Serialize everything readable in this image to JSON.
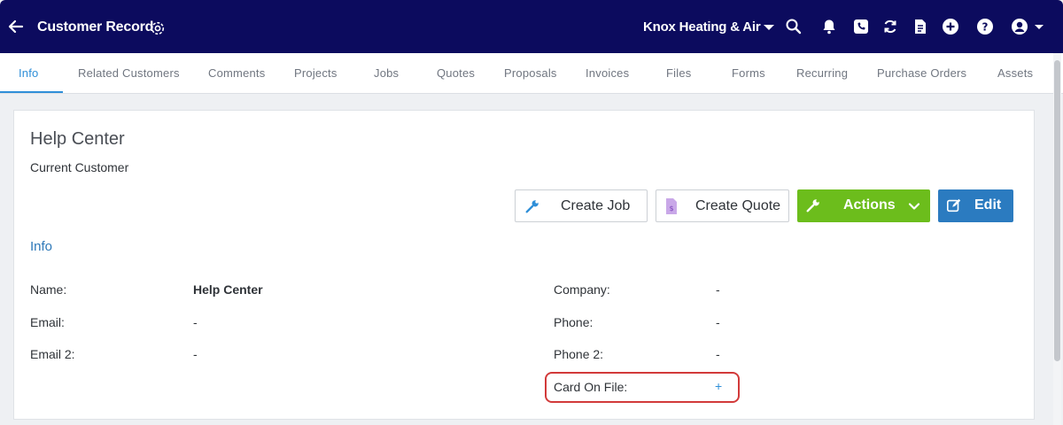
{
  "header": {
    "title": "Customer Record",
    "company": "Knox Heating & Air",
    "icons": [
      "back-arrow-icon",
      "gear-icon",
      "caret-down-icon",
      "search-icon",
      "bell-icon",
      "phone-icon",
      "sync-icon",
      "document-icon",
      "plus-circle-icon",
      "help-icon",
      "user-icon"
    ],
    "bg_color": "#0c0b5e"
  },
  "tabs": [
    {
      "label": "Info",
      "active": true
    },
    {
      "label": "Related Customers"
    },
    {
      "label": "Comments"
    },
    {
      "label": "Projects"
    },
    {
      "label": "Jobs"
    },
    {
      "label": "Quotes"
    },
    {
      "label": "Proposals"
    },
    {
      "label": "Invoices"
    },
    {
      "label": "Files"
    },
    {
      "label": "Forms"
    },
    {
      "label": "Recurring"
    },
    {
      "label": "Purchase Orders"
    },
    {
      "label": "Assets"
    }
  ],
  "customer": {
    "name": "Help Center",
    "status": "Current Customer"
  },
  "buttons": {
    "create_job": "Create Job",
    "create_quote": "Create Quote",
    "actions": "Actions",
    "edit": "Edit"
  },
  "colors": {
    "accent": "#2f8fd8",
    "actions_green": "#6cbd1c",
    "edit_blue": "#2b7bc0",
    "highlight_red": "#d23a3a"
  },
  "info": {
    "section_title": "Info",
    "left": [
      {
        "label": "Name:",
        "value": "Help Center"
      },
      {
        "label": "Email:",
        "value": "-"
      },
      {
        "label": "Email 2:",
        "value": "-"
      }
    ],
    "right": [
      {
        "label": "Company:",
        "value": "-"
      },
      {
        "label": "Phone:",
        "value": "-"
      },
      {
        "label": "Phone 2:",
        "value": "-"
      },
      {
        "label": "Card On File:",
        "value": "+"
      }
    ]
  }
}
